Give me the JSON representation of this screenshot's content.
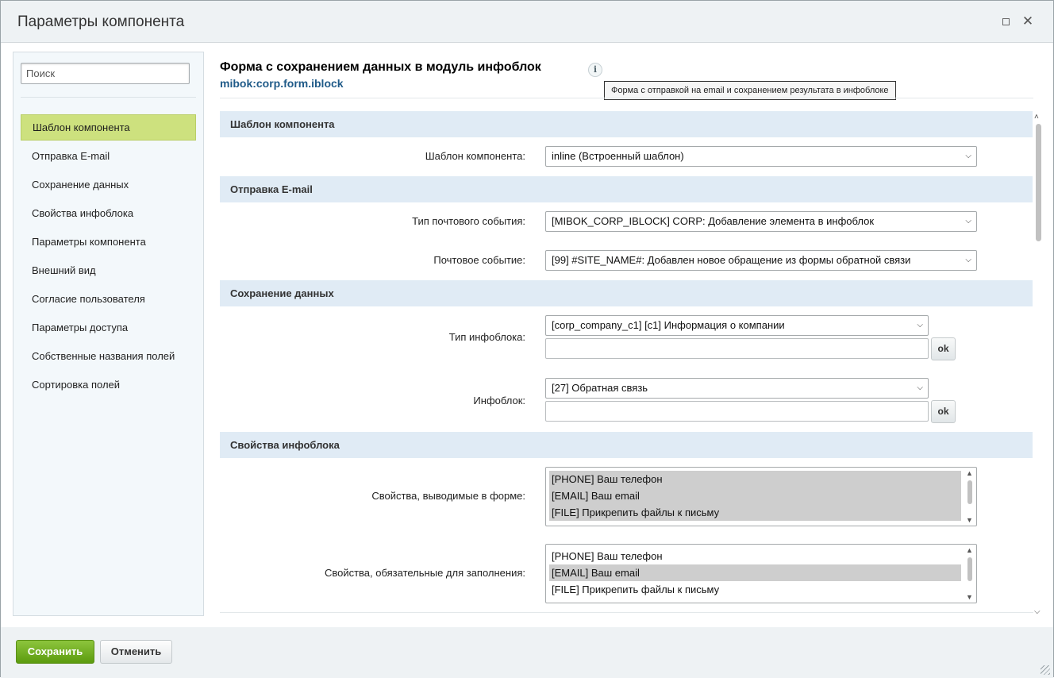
{
  "window": {
    "title": "Параметры компонента"
  },
  "sidebar": {
    "search_placeholder": "Поиск",
    "items": [
      {
        "label": "Шаблон компонента",
        "active": true
      },
      {
        "label": "Отправка E-mail"
      },
      {
        "label": "Сохранение данных"
      },
      {
        "label": "Свойства инфоблока"
      },
      {
        "label": "Параметры компонента"
      },
      {
        "label": "Внешний вид"
      },
      {
        "label": "Согласие пользователя"
      },
      {
        "label": "Параметры доступа"
      },
      {
        "label": "Собственные названия полей"
      },
      {
        "label": "Сортировка полей"
      }
    ]
  },
  "component": {
    "title": "Форма с сохранением данных в модуль инфоблок",
    "code": "mibok:corp.form.iblock",
    "tooltip": "Форма с отправкой на email и сохранением результата в инфоблоке"
  },
  "sections": {
    "template": {
      "title": "Шаблон компонента",
      "template_label": "Шаблон компонента:",
      "template_value": "inline (Встроенный шаблон)"
    },
    "email": {
      "title": "Отправка E-mail",
      "event_type_label": "Тип почтового события:",
      "event_type_value": "[MIBOK_CORP_IBLOCK] CORP: Добавление элемента в инфоблок",
      "event_label": "Почтовое событие:",
      "event_value": "[99] #SITE_NAME#: Добавлен новое обращение из формы обратной связи"
    },
    "storage": {
      "title": "Сохранение данных",
      "iblock_type_label": "Тип инфоблока:",
      "iblock_type_value": "[corp_company_c1] [c1] Информация о компании",
      "iblock_label": "Инфоблок:",
      "iblock_value": "[27] Обратная связь",
      "ok_label": "ok"
    },
    "properties": {
      "title": "Свойства инфоблока",
      "shown_label": "Свойства, выводимые в форме:",
      "shown_options": [
        {
          "label": "[PHONE] Ваш телефон",
          "selected": true
        },
        {
          "label": "[EMAIL] Ваш email",
          "selected": true
        },
        {
          "label": "[FILE] Прикрепить файлы к письму",
          "selected": true
        }
      ],
      "required_label": "Свойства, обязательные для заполнения:",
      "required_options": [
        {
          "label": "[PHONE] Ваш телефон",
          "selected": false
        },
        {
          "label": "[EMAIL] Ваш email",
          "selected": true
        },
        {
          "label": "[FILE] Прикрепить файлы к письму",
          "selected": false
        }
      ]
    }
  },
  "footer": {
    "save_label": "Сохранить",
    "cancel_label": "Отменить"
  },
  "colors": {
    "accent_green": "#7ab52a",
    "active_item": "#cde17e",
    "section_bg": "#e0ebf5",
    "code_link": "#1f5a88"
  }
}
